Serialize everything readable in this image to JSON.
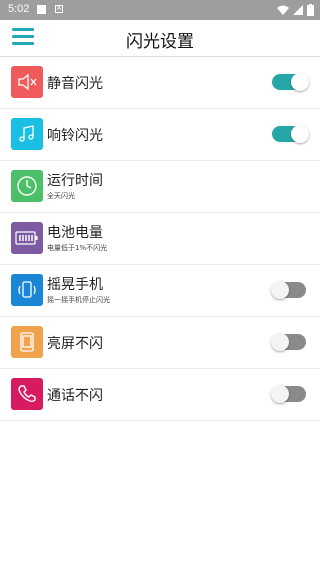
{
  "status_bar": {
    "time": "5:02",
    "icons": [
      "notification-square-icon",
      "a-icon",
      "wifi-icon",
      "signal-icon",
      "battery-icon"
    ]
  },
  "header": {
    "title": "闪光设置",
    "menu_icon": "hamburger-menu-icon"
  },
  "colors": {
    "accent": "#26a7b4",
    "toggle_on": "#26a7a7",
    "toggle_off": "#8a8a8a"
  },
  "settings": [
    {
      "label": "静音闪光",
      "subtitle": "",
      "icon": "mute-speaker-icon",
      "icon_color": "#ef5b5b",
      "toggle": true,
      "toggle_on": true
    },
    {
      "label": "响铃闪光",
      "subtitle": "",
      "icon": "music-note-icon",
      "icon_color": "#19c0e4",
      "toggle": true,
      "toggle_on": true
    },
    {
      "label": "运行时间",
      "subtitle": "全天闪光",
      "icon": "clock-icon",
      "icon_color": "#4cc068",
      "toggle": false
    },
    {
      "label": "电池电量",
      "subtitle": "电量低于1%不闪光",
      "icon": "battery-level-icon",
      "icon_color": "#7c5ba2",
      "toggle": false
    },
    {
      "label": "摇晃手机",
      "subtitle": "摇一摇手机停止闪光",
      "icon": "shake-phone-icon",
      "icon_color": "#1a86d6",
      "toggle": true,
      "toggle_on": false
    },
    {
      "label": "亮屏不闪",
      "subtitle": "",
      "icon": "tablet-screen-icon",
      "icon_color": "#f0a24d",
      "toggle": true,
      "toggle_on": false
    },
    {
      "label": "通话不闪",
      "subtitle": "",
      "icon": "phone-call-icon",
      "icon_color": "#d81b60",
      "toggle": true,
      "toggle_on": false
    }
  ]
}
